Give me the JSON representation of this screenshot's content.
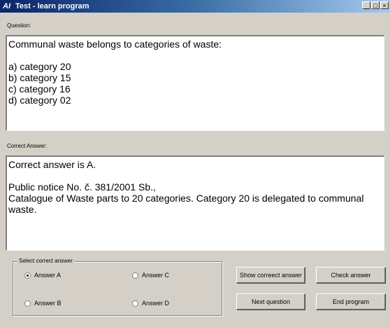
{
  "window": {
    "icon_text": "AI",
    "title": "Test - learn program",
    "minimize": "_",
    "maximize": "□",
    "close": "×"
  },
  "question": {
    "label": "Question:",
    "text": "Communal waste belongs to categories of waste:\n\na) category 20\nb) category 15\nc) category 16\nd) category 02"
  },
  "answer": {
    "label": "Correct Answer:",
    "text": "Correct answer is A.\n\nPublic notice No. č. 381/2001 Sb.,\nCatalogue of Waste parts to 20 categories. Category 20 is delegated to communal waste."
  },
  "select": {
    "legend": "Select correct answer",
    "options": [
      {
        "label": "Answer A",
        "checked": true
      },
      {
        "label": "Answer B",
        "checked": false
      },
      {
        "label": "Answer C",
        "checked": false
      },
      {
        "label": "Answer D",
        "checked": false
      }
    ]
  },
  "buttons": {
    "show_answer": "Show correect answer",
    "check_answer": "Check answer",
    "next_question": "Next question",
    "end_program": "End program"
  }
}
